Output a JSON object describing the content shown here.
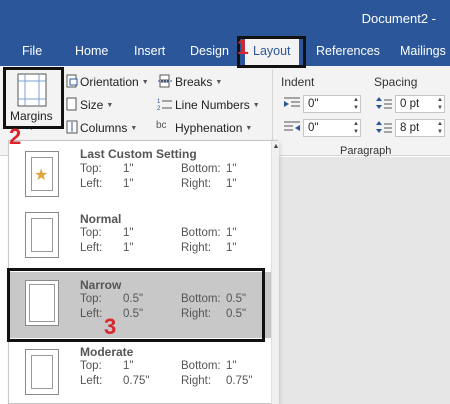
{
  "window": {
    "title": "Document2 -"
  },
  "tabs": [
    {
      "label": "File"
    },
    {
      "label": "Home"
    },
    {
      "label": "Insert"
    },
    {
      "label": "Design"
    },
    {
      "label": "Layout"
    },
    {
      "label": "References"
    },
    {
      "label": "Mailings"
    }
  ],
  "ribbon": {
    "margins": "Margins",
    "orientation": "Orientation",
    "size": "Size",
    "columns": "Columns",
    "breaks": "Breaks",
    "line_numbers": "Line Numbers",
    "hyphenation": "Hyphenation",
    "indent_label": "Indent",
    "spacing_label": "Spacing",
    "indent_left": "0\"",
    "indent_right": "0\"",
    "spacing_before": "0 pt",
    "spacing_after": "8 pt",
    "paragraph_group": "Paragraph"
  },
  "steps": {
    "one": "1",
    "two": "2",
    "three": "3"
  },
  "margin_options": [
    {
      "name": "Last Custom Setting",
      "top_label": "Top:",
      "top": "1\"",
      "bottom_label": "Bottom:",
      "bottom": "1\"",
      "left_label": "Left:",
      "left": "1\"",
      "right_label": "Right:",
      "right": "1\""
    },
    {
      "name": "Normal",
      "top_label": "Top:",
      "top": "1\"",
      "bottom_label": "Bottom:",
      "bottom": "1\"",
      "left_label": "Left:",
      "left": "1\"",
      "right_label": "Right:",
      "right": "1\""
    },
    {
      "name": "Narrow",
      "top_label": "Top:",
      "top": "0.5\"",
      "bottom_label": "Bottom:",
      "bottom": "0.5\"",
      "left_label": "Left:",
      "left": "0.5\"",
      "right_label": "Right:",
      "right": "0.5\""
    },
    {
      "name": "Moderate",
      "top_label": "Top:",
      "top": "1\"",
      "bottom_label": "Bottom:",
      "bottom": "1\"",
      "left_label": "Left:",
      "left": "0.75\"",
      "right_label": "Right:",
      "right": "0.75\""
    }
  ],
  "colors": {
    "ribbon_blue": "#2b579a",
    "annotation_red": "#d9262a",
    "star": "#e0a43a"
  }
}
